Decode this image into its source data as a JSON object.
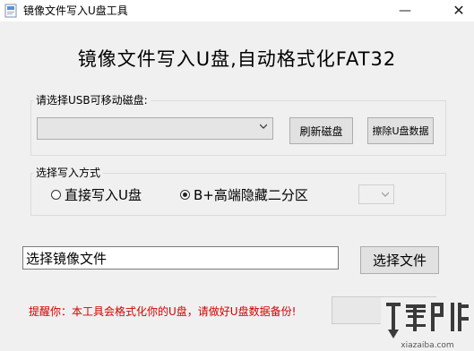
{
  "window": {
    "title": "镜像文件写入U盘工具",
    "minimize_glyph": "—",
    "close_glyph": "✕"
  },
  "heading": "镜像文件写入U盘,自动格式化FAT32",
  "usb_group": {
    "label": "请选择USB可移动磁盘:",
    "combo_value": "",
    "refresh_label": "刷新磁盘",
    "erase_label": "擦除U盘数据"
  },
  "mode_group": {
    "label": "选择写入方式",
    "option_direct": "直接写入U盘",
    "option_hidden": "B+高端隐藏二分区",
    "selected": "B+高端隐藏二分区",
    "partition_value": ""
  },
  "file": {
    "value": "选择镜像文件",
    "choose_label": "选择文件"
  },
  "warning": "提醒你：本工具会格式化你的U盘，请做好U盘数据备份!",
  "write_button_label": "",
  "watermark": {
    "icon": "download-arrow-logo",
    "text": "xiazaiba.com"
  },
  "colors": {
    "window_bg": "#f0f0f0",
    "button_bg": "#e1e1e1",
    "warning_text": "#d10000",
    "watermark": "#444444"
  }
}
